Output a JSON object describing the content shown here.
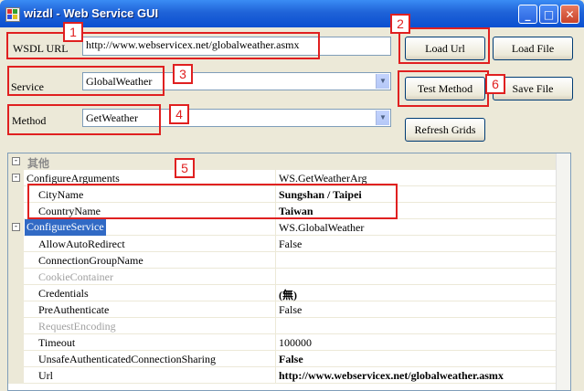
{
  "window": {
    "title": "wizdl - Web Service GUI",
    "controls": [
      "_",
      "□",
      "✕"
    ]
  },
  "form": {
    "wsdl_label": "WSDL URL",
    "wsdl_value": "http://www.webservicex.net/globalweather.asmx",
    "service_label": "Service",
    "service_value": "GlobalWeather",
    "method_label": "Method",
    "method_value": "GetWeather"
  },
  "buttons": {
    "load_url": "Load Url",
    "load_file": "Load File",
    "test_method": "Test Method",
    "save_file": "Save File",
    "refresh_grids": "Refresh Grids"
  },
  "callouts": [
    "1",
    "2",
    "3",
    "4",
    "5",
    "6"
  ],
  "grid": {
    "category": "其他",
    "rows": [
      {
        "name": "ConfigureArguments",
        "value": "WS.GetWeatherArg"
      },
      {
        "name": "CityName",
        "value": "Sungshan / Taipei"
      },
      {
        "name": "CountryName",
        "value": "Taiwan"
      },
      {
        "name": "ConfigureService",
        "value": "WS.GlobalWeather"
      },
      {
        "name": "AllowAutoRedirect",
        "value": "False"
      },
      {
        "name": "ConnectionGroupName",
        "value": ""
      },
      {
        "name": "CookieContainer",
        "value": ""
      },
      {
        "name": "Credentials",
        "value": "(無)"
      },
      {
        "name": "PreAuthenticate",
        "value": "False"
      },
      {
        "name": "RequestEncoding",
        "value": ""
      },
      {
        "name": "Timeout",
        "value": "100000"
      },
      {
        "name": "UnsafeAuthenticatedConnectionSharing",
        "value": "False"
      },
      {
        "name": "Url",
        "value": "http://www.webservicex.net/globalweather.asmx"
      }
    ]
  },
  "colors": {
    "accent_red": "#e02020",
    "title_blue": "#0a4fd0",
    "selection": "#316ac5"
  },
  "icons": [
    "app-icon",
    "combo-dropdown-arrow-icon",
    "collapse-icon"
  ]
}
